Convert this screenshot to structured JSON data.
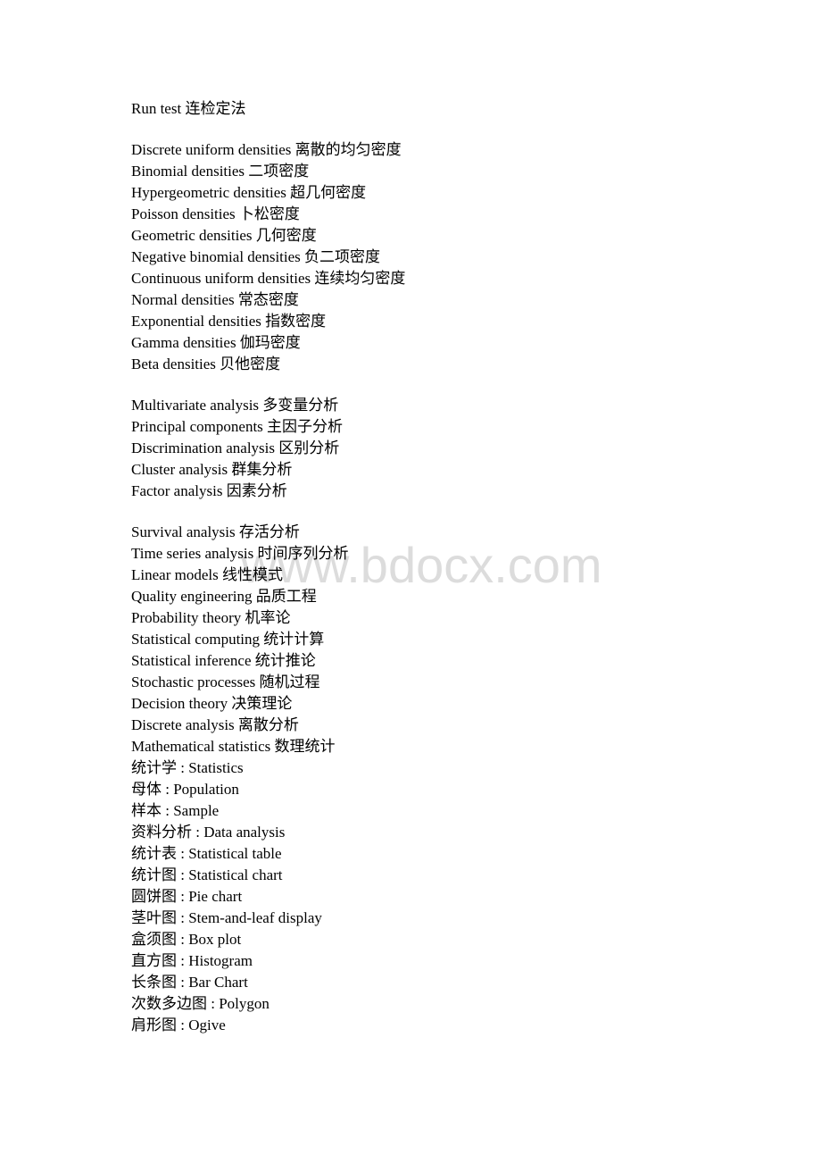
{
  "watermark": "www.bdocx.com",
  "sections": [
    {
      "lines": [
        "Run test 连检定法"
      ]
    },
    {
      "lines": [
        "Discrete uniform densities 离散的均匀密度",
        "Binomial densities 二项密度",
        "Hypergeometric densities 超几何密度",
        "Poisson densities 卜松密度",
        "Geometric densities 几何密度",
        "Negative binomial densities 负二项密度",
        "Continuous uniform densities 连续均匀密度",
        "Normal densities 常态密度",
        "Exponential densities 指数密度",
        "Gamma densities 伽玛密度",
        "Beta densities 贝他密度"
      ]
    },
    {
      "lines": [
        "Multivariate analysis 多变量分析",
        "Principal components 主因子分析",
        "Discrimination analysis 区别分析",
        "Cluster analysis 群集分析",
        "Factor analysis 因素分析"
      ]
    },
    {
      "lines": [
        "Survival analysis 存活分析",
        "Time series analysis 时间序列分析",
        "Linear models 线性模式",
        "Quality engineering 品质工程",
        "Probability theory 机率论",
        "Statistical computing 统计计算",
        "Statistical inference 统计推论",
        "Stochastic processes 随机过程",
        "Decision theory 决策理论",
        "Discrete analysis 离散分析",
        "Mathematical statistics 数理统计",
        "统计学 : Statistics",
        "母体 : Population",
        "样本 : Sample",
        "资料分析 : Data analysis",
        "统计表 : Statistical table",
        "统计图 : Statistical chart",
        "圆饼图 : Pie chart",
        "茎叶图 : Stem-and-leaf display",
        "盒须图 : Box plot",
        "直方图 : Histogram",
        "长条图 : Bar Chart",
        "次数多边图 : Polygon",
        "肩形图 : Ogive"
      ]
    }
  ]
}
